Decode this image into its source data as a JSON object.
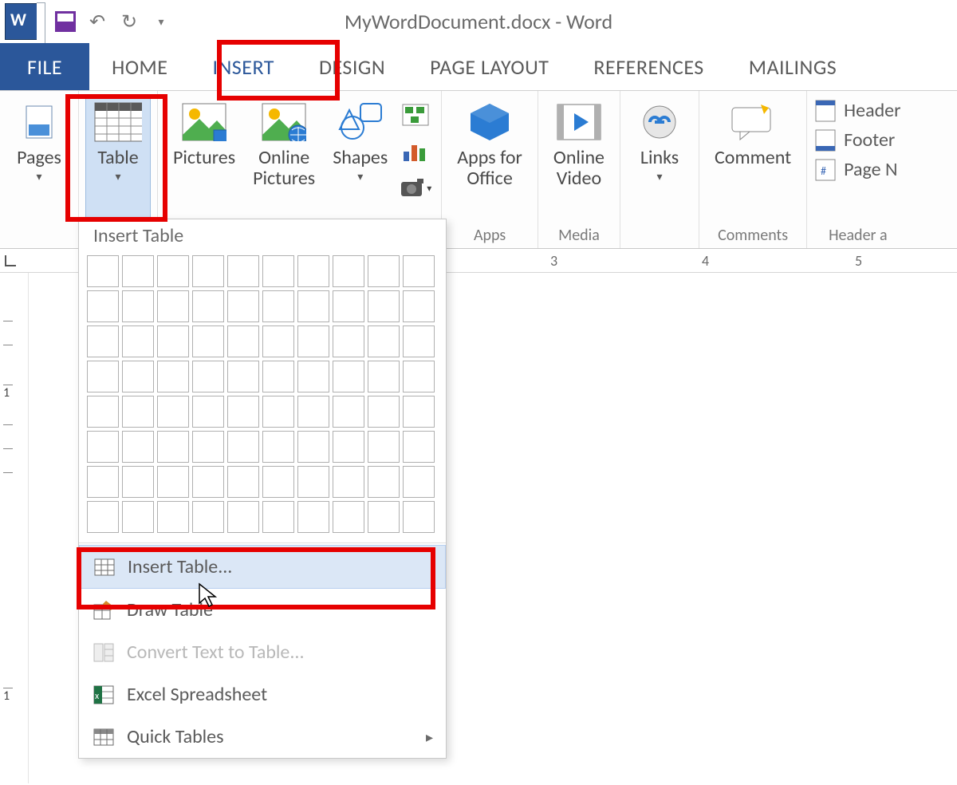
{
  "title": "MyWordDocument.docx - Word",
  "tabs": {
    "file": "FILE",
    "home": "HOME",
    "insert": "INSERT",
    "design": "DESIGN",
    "page_layout": "PAGE LAYOUT",
    "references": "REFERENCES",
    "mailings": "MAILINGS"
  },
  "ribbon": {
    "pages": {
      "label": "Pages"
    },
    "table": {
      "label": "Table"
    },
    "pictures": {
      "label": "Pictures"
    },
    "online_pictures": {
      "label": "Online\nPictures"
    },
    "shapes": {
      "label": "Shapes"
    },
    "apps": {
      "label": "Apps for\nOffice",
      "group": "Apps"
    },
    "video": {
      "label": "Online\nVideo",
      "group": "Media"
    },
    "links": {
      "label": "Links"
    },
    "comment": {
      "label": "Comment",
      "group": "Comments"
    },
    "hf": {
      "header": "Header",
      "footer": "Footer",
      "page_no": "Page N",
      "group": "Header a"
    }
  },
  "dropdown": {
    "title": "Insert Table",
    "items": {
      "insert_table": "Insert Table...",
      "draw_table": "Draw Table",
      "convert": "Convert Text to Table...",
      "excel": "Excel Spreadsheet",
      "quick": "Quick Tables"
    }
  },
  "ruler": {
    "n3": "3",
    "n4": "4",
    "n5": "5"
  }
}
